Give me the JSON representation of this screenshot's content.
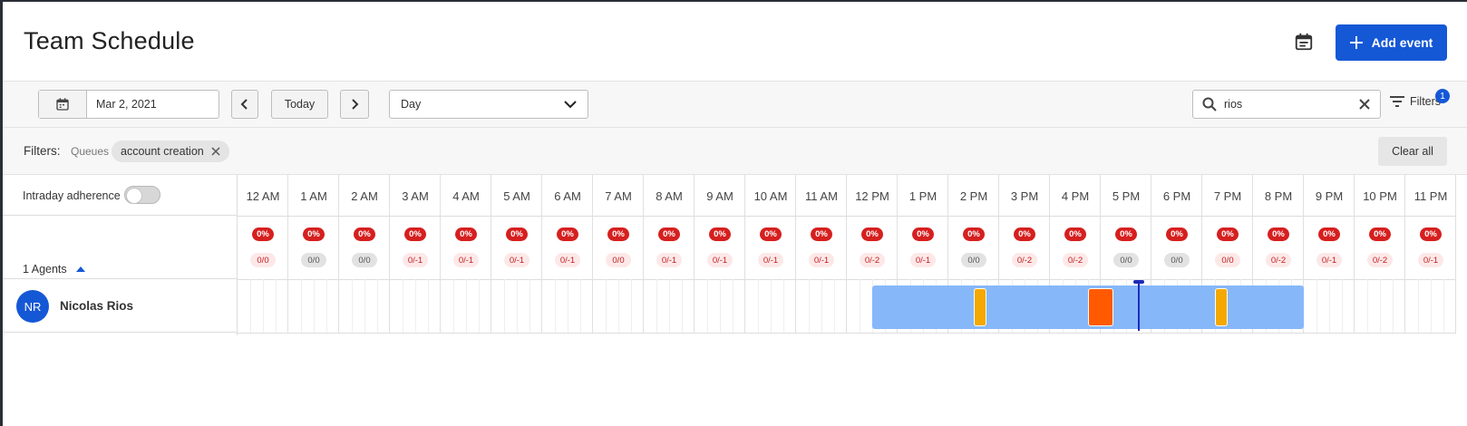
{
  "header": {
    "title": "Team Schedule",
    "calendar_icon": "calendar-icon",
    "add_event_label": "Add event"
  },
  "toolbar": {
    "date_value": "Mar 2, 2021",
    "today_label": "Today",
    "view_value": "Day",
    "search_value": "rios",
    "filters_label": "Filters",
    "filters_count": "1"
  },
  "filters": {
    "label": "Filters:",
    "category": "Queues",
    "chip_label": "account creation",
    "clear_all_label": "Clear all"
  },
  "grid": {
    "adherence_label": "Intraday adherence",
    "adherence_on": false,
    "agents_label": "1 Agents",
    "hours": [
      {
        "label": "12 AM",
        "pct": "0%",
        "ratio": "0/0",
        "ratio_type": "neg"
      },
      {
        "label": "1 AM",
        "pct": "0%",
        "ratio": "0/0",
        "ratio_type": "zero"
      },
      {
        "label": "2 AM",
        "pct": "0%",
        "ratio": "0/0",
        "ratio_type": "zero"
      },
      {
        "label": "3 AM",
        "pct": "0%",
        "ratio": "0/-1",
        "ratio_type": "neg"
      },
      {
        "label": "4 AM",
        "pct": "0%",
        "ratio": "0/-1",
        "ratio_type": "neg"
      },
      {
        "label": "5 AM",
        "pct": "0%",
        "ratio": "0/-1",
        "ratio_type": "neg"
      },
      {
        "label": "6 AM",
        "pct": "0%",
        "ratio": "0/-1",
        "ratio_type": "neg"
      },
      {
        "label": "7 AM",
        "pct": "0%",
        "ratio": "0/0",
        "ratio_type": "neg"
      },
      {
        "label": "8 AM",
        "pct": "0%",
        "ratio": "0/-1",
        "ratio_type": "neg"
      },
      {
        "label": "9 AM",
        "pct": "0%",
        "ratio": "0/-1",
        "ratio_type": "neg"
      },
      {
        "label": "10 AM",
        "pct": "0%",
        "ratio": "0/-1",
        "ratio_type": "neg"
      },
      {
        "label": "11 AM",
        "pct": "0%",
        "ratio": "0/-1",
        "ratio_type": "neg"
      },
      {
        "label": "12 PM",
        "pct": "0%",
        "ratio": "0/-2",
        "ratio_type": "neg"
      },
      {
        "label": "1 PM",
        "pct": "0%",
        "ratio": "0/-1",
        "ratio_type": "neg"
      },
      {
        "label": "2 PM",
        "pct": "0%",
        "ratio": "0/0",
        "ratio_type": "zero"
      },
      {
        "label": "3 PM",
        "pct": "0%",
        "ratio": "0/-2",
        "ratio_type": "neg"
      },
      {
        "label": "4 PM",
        "pct": "0%",
        "ratio": "0/-2",
        "ratio_type": "neg"
      },
      {
        "label": "5 PM",
        "pct": "0%",
        "ratio": "0/0",
        "ratio_type": "zero"
      },
      {
        "label": "6 PM",
        "pct": "0%",
        "ratio": "0/0",
        "ratio_type": "zero"
      },
      {
        "label": "7 PM",
        "pct": "0%",
        "ratio": "0/0",
        "ratio_type": "neg"
      },
      {
        "label": "8 PM",
        "pct": "0%",
        "ratio": "0/-2",
        "ratio_type": "neg"
      },
      {
        "label": "9 PM",
        "pct": "0%",
        "ratio": "0/-1",
        "ratio_type": "neg"
      },
      {
        "label": "10 PM",
        "pct": "0%",
        "ratio": "0/-2",
        "ratio_type": "neg"
      },
      {
        "label": "11 PM",
        "pct": "0%",
        "ratio": "0/-1",
        "ratio_type": "neg"
      }
    ]
  },
  "agents": [
    {
      "initials": "NR",
      "name": "Nicolas Rios",
      "shift": {
        "start_hour": 12.5,
        "end_hour": 21.0,
        "color": "#86b7f9"
      },
      "breaks": [
        {
          "start_hour": 14.5,
          "end_hour": 14.75,
          "color": "#f5a800"
        },
        {
          "start_hour": 16.75,
          "end_hour": 17.25,
          "color": "#ff5a00"
        },
        {
          "start_hour": 19.25,
          "end_hour": 19.5,
          "color": "#f5a800"
        }
      ]
    }
  ],
  "current_time_hour": 17.75,
  "colors": {
    "accent": "#1558d6",
    "pct_badge": "#d61f1f",
    "now_line": "#1f2bb8"
  }
}
